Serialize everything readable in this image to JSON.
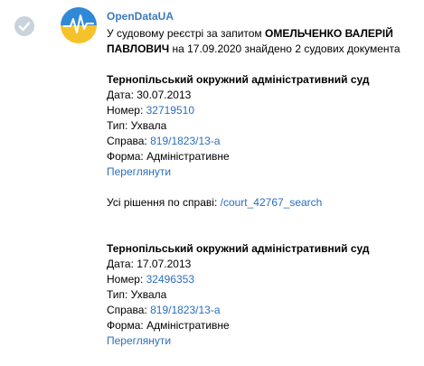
{
  "colors": {
    "sender_name": "#3a7abf",
    "link": "#2a6ebd",
    "check_badge": "#c9d3dc",
    "avatar_top": "#2f89d6",
    "avatar_bottom": "#f5c22a"
  },
  "icons": {
    "check": "check-icon",
    "avatar": "opendataua-logo"
  },
  "message": {
    "sender": "OpenDataUA",
    "intro_prefix": "У судовому реєстрі за запитом ",
    "intro_name": "ОМЕЛЬЧЕНКО ВАЛЕРІЙ ПАВЛОВИЧ",
    "intro_suffix": " на 17.09.2020 знайдено 2 судових документа",
    "all_decisions_label": "Усі рішення по справі: ",
    "all_decisions_link": "/court_42767_search",
    "documents": [
      {
        "court": "Тернопільський окружний адміністративний суд",
        "date_label": "Дата: ",
        "date": "30.07.2013",
        "number_label": "Номер: ",
        "number": "32719510",
        "type_label": "Тип: ",
        "type": "Ухвала",
        "case_label": "Справа: ",
        "case": "819/1823/13-а",
        "form_label": "Форма: ",
        "form": "Адміністративне",
        "view_link": "Переглянути"
      },
      {
        "court": "Тернопільський окружний адміністративний суд",
        "date_label": "Дата: ",
        "date": "17.07.2013",
        "number_label": "Номер: ",
        "number": "32496353",
        "type_label": "Тип: ",
        "type": "Ухвала",
        "case_label": "Справа: ",
        "case": "819/1823/13-а",
        "form_label": "Форма: ",
        "form": "Адміністративне",
        "view_link": "Переглянути"
      }
    ]
  }
}
